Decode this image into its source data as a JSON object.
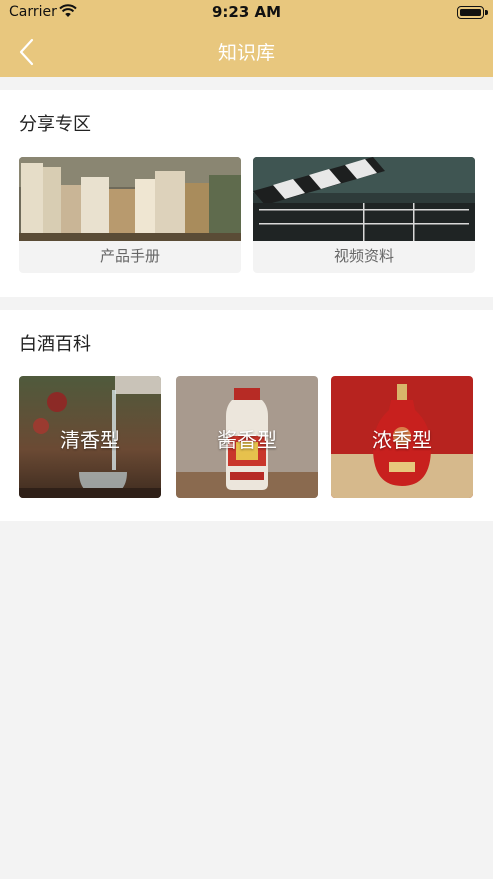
{
  "status_bar": {
    "carrier": "Carrier",
    "time": "9:23 AM"
  },
  "nav": {
    "title": "知识库",
    "back_icon": "chevron-left-icon"
  },
  "share_section": {
    "title": "分享专区",
    "items": [
      {
        "label": "产品手册"
      },
      {
        "label": "视频资料"
      }
    ]
  },
  "baijiu_section": {
    "title": "白酒百科",
    "items": [
      {
        "label": "清香型"
      },
      {
        "label": "酱香型"
      },
      {
        "label": "浓香型"
      }
    ]
  },
  "colors": {
    "accent": "#e8c77e",
    "background": "#f3f3f3"
  }
}
